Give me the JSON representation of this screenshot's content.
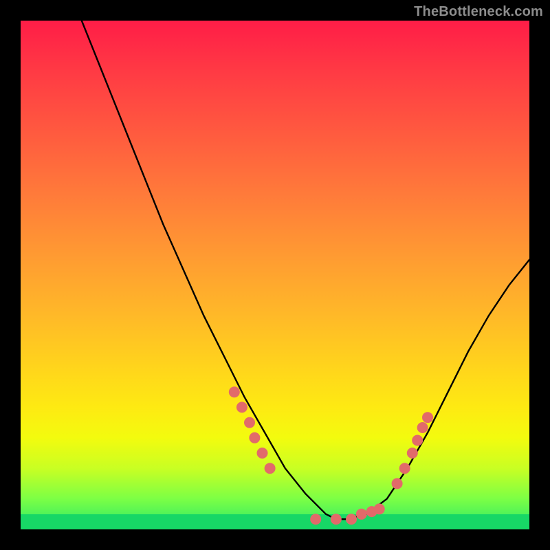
{
  "watermark": "TheBottleneck.com",
  "chart_data": {
    "type": "line",
    "title": "",
    "xlabel": "",
    "ylabel": "",
    "xlim": [
      0,
      100
    ],
    "ylim": [
      0,
      100
    ],
    "grid": false,
    "legend": false,
    "background_gradient": {
      "orientation": "vertical",
      "stops": [
        {
          "pos": 0,
          "color": "#ff1d47"
        },
        {
          "pos": 50,
          "color": "#ffb928"
        },
        {
          "pos": 80,
          "color": "#f3fb0e"
        },
        {
          "pos": 100,
          "color": "#17d766"
        }
      ]
    },
    "series": [
      {
        "name": "bottleneck-curve",
        "color": "#000000",
        "x": [
          12,
          16,
          20,
          24,
          28,
          32,
          36,
          40,
          44,
          48,
          52,
          56,
          60,
          62,
          64,
          68,
          72,
          76,
          80,
          84,
          88,
          92,
          96,
          100
        ],
        "y": [
          100,
          90,
          80,
          70,
          60,
          51,
          42,
          34,
          26,
          19,
          12,
          7,
          3,
          2,
          2,
          3,
          6,
          12,
          19,
          27,
          35,
          42,
          48,
          53
        ]
      },
      {
        "name": "highlight-dots-left",
        "type": "scatter",
        "color": "#e26a6a",
        "x": [
          42,
          43.5,
          45,
          46,
          47.5,
          49
        ],
        "y": [
          27,
          24,
          21,
          18,
          15,
          12
        ]
      },
      {
        "name": "highlight-dots-bottom",
        "type": "scatter",
        "color": "#e26a6a",
        "x": [
          58,
          62,
          65,
          67,
          69,
          70.5
        ],
        "y": [
          2,
          2,
          2,
          3,
          3.5,
          4
        ]
      },
      {
        "name": "highlight-dots-right",
        "type": "scatter",
        "color": "#e26a6a",
        "x": [
          74,
          75.5,
          77,
          78,
          79,
          80
        ],
        "y": [
          9,
          12,
          15,
          17.5,
          20,
          22
        ]
      }
    ]
  }
}
